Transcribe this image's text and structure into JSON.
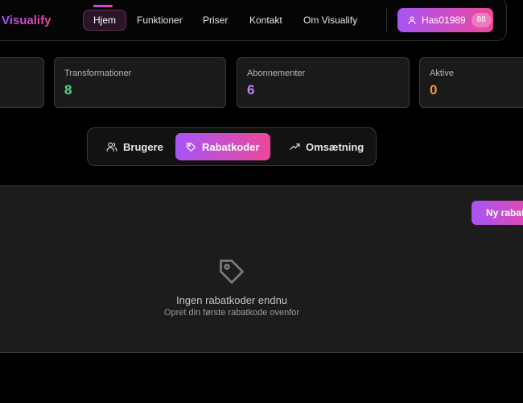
{
  "brand": {
    "name": "Visualify"
  },
  "nav": {
    "items": [
      {
        "label": "Hjem",
        "active": true
      },
      {
        "label": "Funktioner"
      },
      {
        "label": "Priser"
      },
      {
        "label": "Kontakt"
      },
      {
        "label": "Om Visualify"
      }
    ],
    "user": {
      "name": "Has01989",
      "badge": "88",
      "icon": "user-icon"
    }
  },
  "stats": [
    {
      "label": "",
      "value": ""
    },
    {
      "label": "Transformationer",
      "value": "8",
      "color": "#4ade80"
    },
    {
      "label": "Abonnementer",
      "value": "6",
      "color": "#c084fc"
    },
    {
      "label": "Aktive",
      "value": "0",
      "color": "#fb923c"
    }
  ],
  "tabs": [
    {
      "label": "Brugere",
      "icon": "users-icon"
    },
    {
      "label": "Rabatkoder",
      "icon": "tag-icon",
      "active": true
    },
    {
      "label": "Omsætning",
      "icon": "trending-up-icon"
    }
  ],
  "panel": {
    "new_button_label": "Ny rabatkode",
    "empty_icon": "tag-icon",
    "empty_title": "Ingen rabatkoder endnu",
    "empty_subtitle": "Opret din første rabatkode ovenfor"
  },
  "colors": {
    "accent_start": "#a855f7",
    "accent_end": "#ec4899"
  }
}
